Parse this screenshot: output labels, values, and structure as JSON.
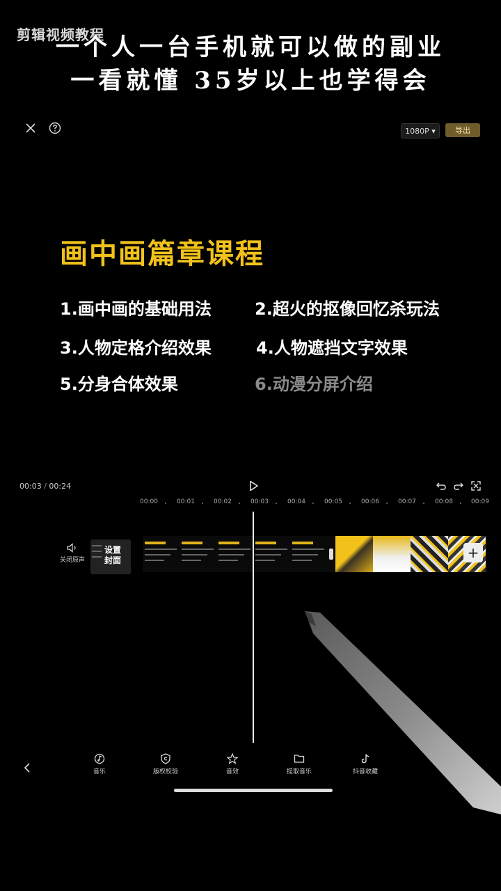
{
  "overlay": {
    "watermark": "剪辑视频教程",
    "banner_line1": "一个人一台手机就可以做的副业",
    "banner_line2": "一看就懂    35岁以上也学得会"
  },
  "toolbar": {
    "close_icon": "close-icon",
    "help_icon": "help-icon",
    "resolution_label": "1080P ▾",
    "export_label": "导出"
  },
  "canvas": {
    "title": "画中画篇章课程",
    "lessons": [
      "1.画中画的基础用法",
      "2.超火的抠像回忆杀玩法",
      "3.人物定格介绍效果",
      "4.人物遮挡文字效果",
      "5.分身合体效果",
      "6.动漫分屏介绍"
    ]
  },
  "playback": {
    "current_time": "00:03",
    "separator": "/",
    "total_time": "00:24",
    "ruler": [
      "00:00",
      "00:01",
      "00:02",
      "00:03",
      "00:04",
      "00:05",
      "00:06",
      "00:07",
      "00:08",
      "00:09"
    ]
  },
  "tracks": {
    "mute_label": "关闭原声",
    "cover_label": "设置\n封面",
    "add_clip": "+"
  },
  "bottom_tools": [
    {
      "label": "音乐",
      "icon": "music-icon"
    },
    {
      "label": "版权校验",
      "icon": "copyright-shield-icon"
    },
    {
      "label": "音效",
      "icon": "sound-effect-icon"
    },
    {
      "label": "提取音乐",
      "icon": "extract-music-folder-icon"
    },
    {
      "label": "抖音收藏",
      "icon": "douyin-icon"
    }
  ],
  "colors": {
    "accent_yellow": "#f2c21b",
    "export_bg": "#6e5c2a"
  }
}
